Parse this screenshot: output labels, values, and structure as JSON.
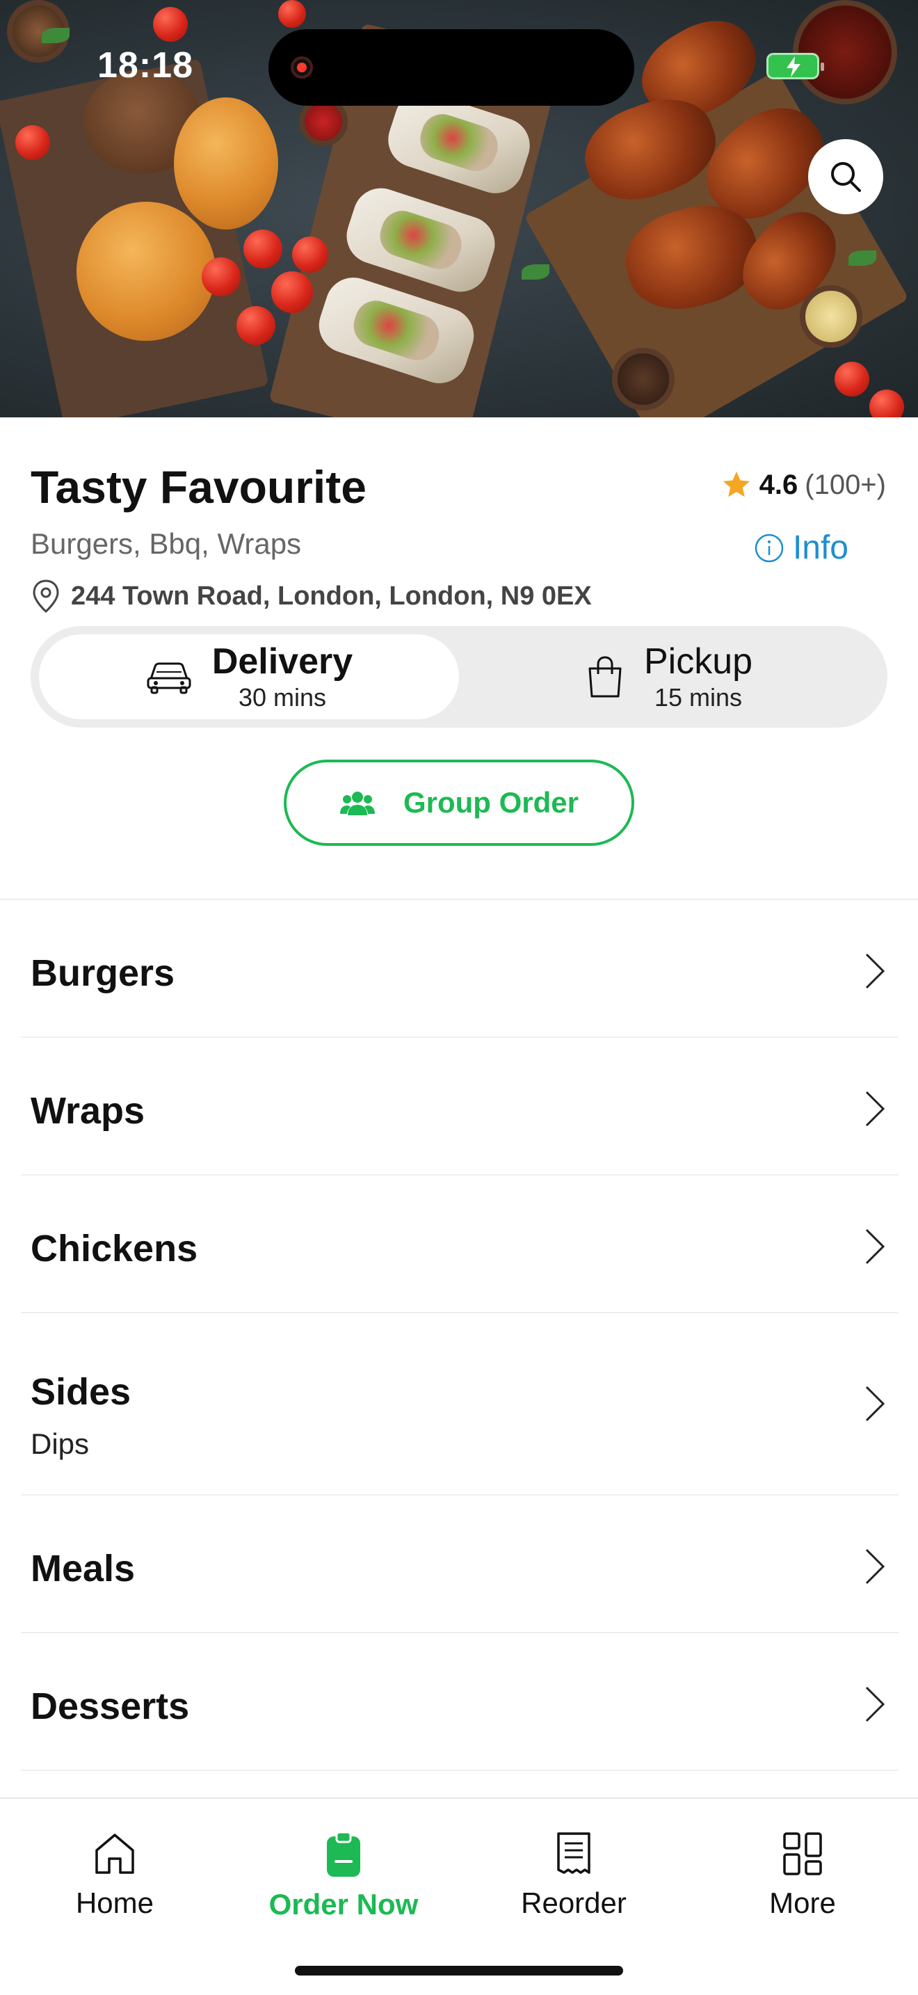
{
  "status_bar": {
    "time": "18:18",
    "battery_icon": "battery-charging-icon",
    "recording_icon": "screen-record-icon"
  },
  "hero": {
    "search_icon": "search-icon",
    "image": "food-spread-photo"
  },
  "restaurant": {
    "name": "Tasty Favourite",
    "rating": "4.6",
    "rating_count": "(100+)",
    "cuisines": "Burgers, Bbq, Wraps",
    "info_label": "Info",
    "address": "244 Town Road, London, London, N9 0EX"
  },
  "order_mode": {
    "delivery": {
      "label": "Delivery",
      "time": "30 mins",
      "icon": "car-icon",
      "selected": true
    },
    "pickup": {
      "label": "Pickup",
      "time": "15 mins",
      "icon": "shopping-bag-icon",
      "selected": false
    }
  },
  "group_order": {
    "label": "Group Order",
    "icon": "group-icon"
  },
  "menu": {
    "categories": [
      {
        "name": "Burgers",
        "sub": ""
      },
      {
        "name": "Wraps",
        "sub": ""
      },
      {
        "name": "Chickens",
        "sub": ""
      },
      {
        "name": "Sides",
        "sub": "Dips"
      },
      {
        "name": "Meals",
        "sub": ""
      },
      {
        "name": "Desserts",
        "sub": ""
      }
    ]
  },
  "tabbar": {
    "items": [
      {
        "label": "Home",
        "icon": "home-icon",
        "active": false
      },
      {
        "label": "Order Now",
        "icon": "order-icon",
        "active": true
      },
      {
        "label": "Reorder",
        "icon": "receipt-icon",
        "active": false
      },
      {
        "label": "More",
        "icon": "grid-icon",
        "active": false
      }
    ]
  },
  "colors": {
    "accent": "#1db954",
    "link": "#1c8fd1",
    "star": "#f5a623"
  }
}
